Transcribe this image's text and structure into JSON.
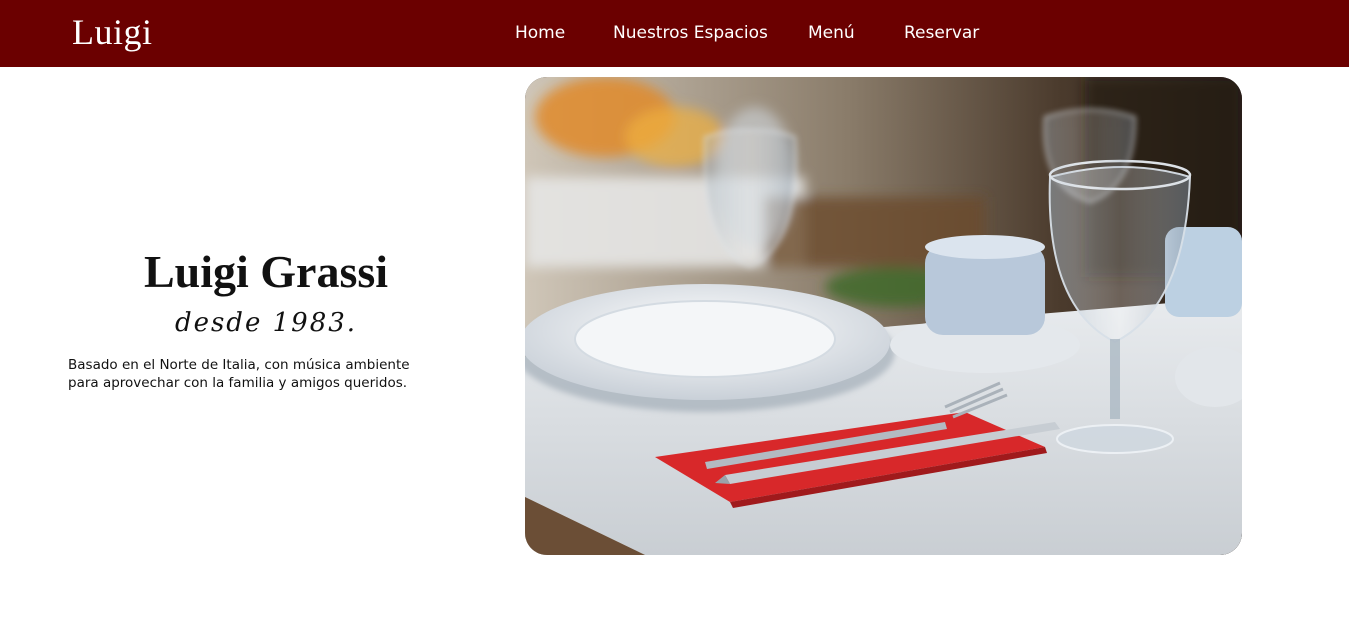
{
  "header": {
    "brand": "Luigi",
    "nav": [
      {
        "label": "Home"
      },
      {
        "label": "Nuestros Espacios"
      },
      {
        "label": "Menú"
      },
      {
        "label": "Reservar"
      }
    ],
    "background_color": "#6b0000"
  },
  "hero": {
    "title": "Luigi Grassi",
    "since": "desde 1983.",
    "description": "Basado en el Norte de Italia, con música ambiente para aprovechar con la familia y amigos queridos.",
    "image_icon": "restaurant-table-photo"
  }
}
